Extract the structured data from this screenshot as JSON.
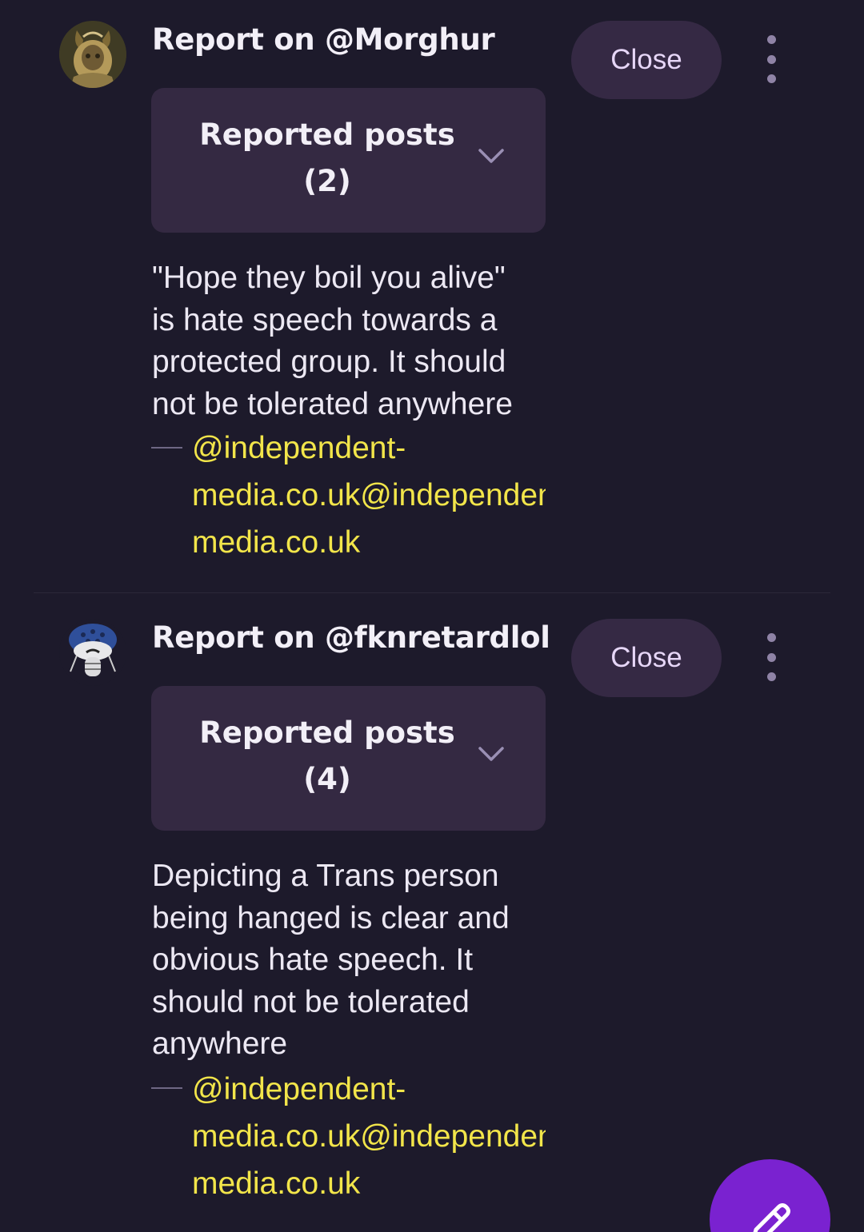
{
  "reports": [
    {
      "avatar": "morghur-avatar",
      "title": "Report on @Morghur",
      "close_label": "Close",
      "more_icon": "more-vertical-icon",
      "posts_label_line1": "Reported posts",
      "posts_label_line2": "(2)",
      "chevron_icon": "chevron-down-icon",
      "reason_lines": [
        "\"Hope they boil you alive\"",
        "is hate speech towards a",
        "protected group. It should",
        "not be tolerated anywhere"
      ],
      "reporter_lines": [
        "@independent-",
        "media.co.uk@independent-",
        "media.co.uk"
      ]
    },
    {
      "avatar": "fknretardlol-avatar",
      "title": "Report on @fknretardlol",
      "close_label": "Close",
      "more_icon": "more-vertical-icon",
      "posts_label_line1": "Reported posts",
      "posts_label_line2": "(4)",
      "chevron_icon": "chevron-down-icon",
      "reason_lines": [
        "Depicting a Trans person",
        "being hanged is clear and",
        "obvious hate speech. It",
        "should not be tolerated",
        "anywhere"
      ],
      "reporter_lines": [
        "@independent-",
        "media.co.uk@independent-",
        "media.co.uk"
      ]
    }
  ],
  "compose_fab": {
    "icon": "pencil-icon"
  },
  "colors": {
    "background": "#1d1a2b",
    "card": "#342942",
    "close_button": "#352944",
    "reporter_link": "#f2e54a",
    "fab": "#7a22d0"
  }
}
